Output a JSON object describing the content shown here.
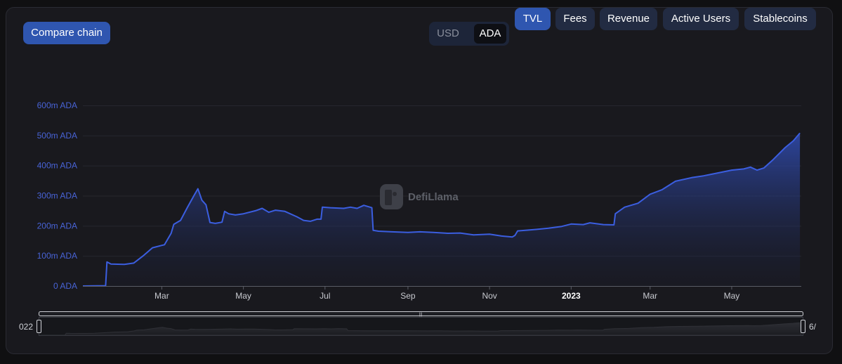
{
  "controls": {
    "compare_label": "Compare chain",
    "currency_options": [
      "USD",
      "ADA"
    ],
    "currency_selected": "ADA",
    "metrics": [
      "TVL",
      "Fees",
      "Revenue",
      "Active Users",
      "Stablecoins"
    ],
    "metric_selected": "TVL"
  },
  "watermark": {
    "text": "DefiLlama"
  },
  "brush": {
    "left_label": "022",
    "right_label": "6/"
  },
  "colors": {
    "line": "#3b5ee0",
    "accent": "#2f56b0",
    "y_tick_label": "#4863d6",
    "x_tick_label": "#c7c9cf",
    "background": "#19191e"
  },
  "chart_data": {
    "type": "area",
    "title": "",
    "xlabel": "",
    "ylabel": "",
    "x_range": [
      "2022-01-01",
      "2023-06-22"
    ],
    "ylim": [
      0,
      600
    ],
    "y_unit": "m ADA",
    "y_ticks": [
      {
        "value": 0,
        "label": "0 ADA"
      },
      {
        "value": 100,
        "label": "100m ADA"
      },
      {
        "value": 200,
        "label": "200m ADA"
      },
      {
        "value": 300,
        "label": "300m ADA"
      },
      {
        "value": 400,
        "label": "400m ADA"
      },
      {
        "value": 500,
        "label": "500m ADA"
      },
      {
        "value": 600,
        "label": "600m ADA"
      }
    ],
    "x_ticks": [
      {
        "date": "2022-03-01",
        "label": "Mar",
        "bold": false
      },
      {
        "date": "2022-05-01",
        "label": "May",
        "bold": false
      },
      {
        "date": "2022-07-01",
        "label": "Jul",
        "bold": false
      },
      {
        "date": "2022-09-01",
        "label": "Sep",
        "bold": false
      },
      {
        "date": "2022-11-01",
        "label": "Nov",
        "bold": false
      },
      {
        "date": "2023-01-01",
        "label": "2023",
        "bold": true
      },
      {
        "date": "2023-03-01",
        "label": "Mar",
        "bold": false
      },
      {
        "date": "2023-05-01",
        "label": "May",
        "bold": false
      }
    ],
    "grid": true,
    "legend": "none",
    "series": [
      {
        "points": [
          [
            "2022-01-01",
            0
          ],
          [
            "2022-01-18",
            1
          ],
          [
            "2022-01-19",
            80
          ],
          [
            "2022-01-22",
            73
          ],
          [
            "2022-02-01",
            72
          ],
          [
            "2022-02-08",
            76
          ],
          [
            "2022-02-15",
            100
          ],
          [
            "2022-02-22",
            127
          ],
          [
            "2022-03-01",
            135
          ],
          [
            "2022-03-03",
            137
          ],
          [
            "2022-03-08",
            175
          ],
          [
            "2022-03-10",
            205
          ],
          [
            "2022-03-15",
            218
          ],
          [
            "2022-03-20",
            260
          ],
          [
            "2022-03-25",
            300
          ],
          [
            "2022-03-28",
            323
          ],
          [
            "2022-03-31",
            285
          ],
          [
            "2022-04-03",
            270
          ],
          [
            "2022-04-06",
            211
          ],
          [
            "2022-04-10",
            208
          ],
          [
            "2022-04-15",
            212
          ],
          [
            "2022-04-17",
            248
          ],
          [
            "2022-04-20",
            240
          ],
          [
            "2022-04-25",
            236
          ],
          [
            "2022-05-01",
            240
          ],
          [
            "2022-05-10",
            250
          ],
          [
            "2022-05-15",
            258
          ],
          [
            "2022-05-20",
            245
          ],
          [
            "2022-05-25",
            252
          ],
          [
            "2022-06-01",
            248
          ],
          [
            "2022-06-10",
            230
          ],
          [
            "2022-06-15",
            218
          ],
          [
            "2022-06-20",
            215
          ],
          [
            "2022-06-25",
            222
          ],
          [
            "2022-06-28",
            222
          ],
          [
            "2022-06-29",
            262
          ],
          [
            "2022-07-05",
            260
          ],
          [
            "2022-07-15",
            258
          ],
          [
            "2022-07-20",
            262
          ],
          [
            "2022-07-25",
            258
          ],
          [
            "2022-07-30",
            268
          ],
          [
            "2022-08-05",
            260
          ],
          [
            "2022-08-06",
            185
          ],
          [
            "2022-08-10",
            182
          ],
          [
            "2022-08-20",
            180
          ],
          [
            "2022-09-01",
            178
          ],
          [
            "2022-09-10",
            180
          ],
          [
            "2022-09-20",
            178
          ],
          [
            "2022-10-01",
            175
          ],
          [
            "2022-10-10",
            176
          ],
          [
            "2022-10-20",
            170
          ],
          [
            "2022-11-01",
            172
          ],
          [
            "2022-11-10",
            166
          ],
          [
            "2022-11-18",
            163
          ],
          [
            "2022-11-20",
            168
          ],
          [
            "2022-11-22",
            183
          ],
          [
            "2022-12-01",
            186
          ],
          [
            "2022-12-15",
            192
          ],
          [
            "2022-12-25",
            198
          ],
          [
            "2023-01-01",
            206
          ],
          [
            "2023-01-10",
            204
          ],
          [
            "2023-01-15",
            210
          ],
          [
            "2023-01-25",
            204
          ],
          [
            "2023-02-02",
            203
          ],
          [
            "2023-02-03",
            240
          ],
          [
            "2023-02-10",
            262
          ],
          [
            "2023-02-20",
            275
          ],
          [
            "2023-03-01",
            305
          ],
          [
            "2023-03-10",
            320
          ],
          [
            "2023-03-20",
            348
          ],
          [
            "2023-04-01",
            360
          ],
          [
            "2023-04-10",
            366
          ],
          [
            "2023-04-20",
            375
          ],
          [
            "2023-05-01",
            385
          ],
          [
            "2023-05-10",
            389
          ],
          [
            "2023-05-15",
            395
          ],
          [
            "2023-05-20",
            385
          ],
          [
            "2023-05-25",
            392
          ],
          [
            "2023-06-01",
            420
          ],
          [
            "2023-06-10",
            460
          ],
          [
            "2023-06-16",
            482
          ],
          [
            "2023-06-21",
            508
          ]
        ]
      }
    ]
  }
}
